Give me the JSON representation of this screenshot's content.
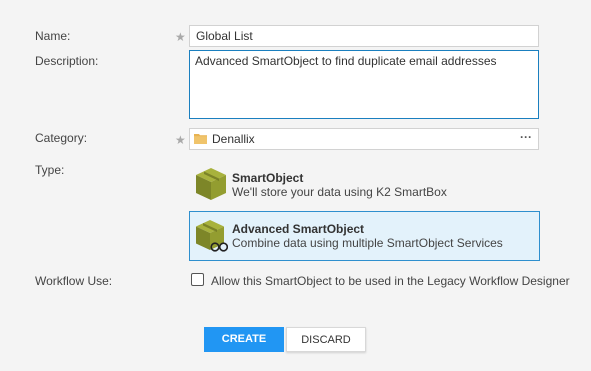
{
  "form": {
    "name_label": "Name:",
    "name_value": "Global List",
    "description_label": "Description:",
    "description_value": "Advanced SmartObject to find duplicate email addresses",
    "category_label": "Category:",
    "category_value": "Denallix",
    "category_button": "···",
    "type_label": "Type:",
    "required_marker": "★",
    "type_options": [
      {
        "title": "SmartObject",
        "description": "We'll store your data using K2 SmartBox",
        "icon": "smartobject-cube-icon",
        "selected": false
      },
      {
        "title": "Advanced SmartObject",
        "description": "Combine data using multiple SmartObject Services",
        "icon": "advanced-smartobject-cube-glasses-icon",
        "selected": true
      }
    ],
    "workflow_label": "Workflow Use:",
    "workflow_checkbox_label": "Allow this SmartObject to be used in the Legacy Workflow Designer",
    "workflow_checked": false
  },
  "buttons": {
    "create": "CREATE",
    "discard": "DISCARD"
  },
  "colors": {
    "accent": "#2196f3",
    "selected_bg": "#e3f2fb",
    "selected_border": "#2e8fce",
    "icon_olive": "#8f9a2e",
    "folder": "#e8b352"
  }
}
